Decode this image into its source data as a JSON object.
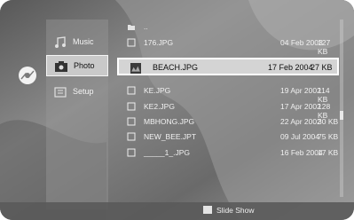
{
  "menu": [
    {
      "label": "Music",
      "active": false
    },
    {
      "label": "Photo",
      "active": true
    },
    {
      "label": "Setup",
      "active": false
    }
  ],
  "files": [
    {
      "name": "..",
      "date": "",
      "size": ""
    },
    {
      "name": "176.JPG",
      "date": "04 Feb 2003",
      "size": "127 KB"
    },
    {
      "name": "BEACH.JPG",
      "date": "17 Feb 2004",
      "size": "27 KB",
      "selected": true
    },
    {
      "name": "KE.JPG",
      "date": "19 Apr 2002",
      "size": "114 KB"
    },
    {
      "name": "KE2.JPG",
      "date": "17 Apr 2002",
      "size": "128 KB"
    },
    {
      "name": "MBHONG.JPG",
      "date": "22 Apr 2002",
      "size": "30 KB"
    },
    {
      "name": "NEW_BEE.JPT",
      "date": "09 Jul 2004",
      "size": "75 KB"
    },
    {
      "name": "_____1_.JPG",
      "date": "16 Feb 2004",
      "size": "17 KB"
    }
  ],
  "footer": {
    "slide_show_label": "Slide Show"
  },
  "colors": {
    "key_indicator": "#e4e4e4"
  }
}
